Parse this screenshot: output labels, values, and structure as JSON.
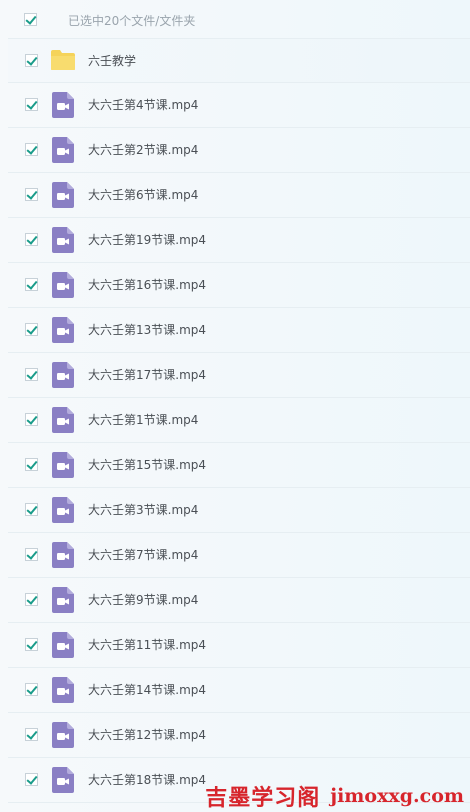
{
  "header": {
    "selection_text": "已选中20个文件/文件夹",
    "select_all_checked": true
  },
  "colors": {
    "checkmark": "#1a9c8a",
    "folder": "#f5d35a",
    "video_icon": "#8a7fc4",
    "watermark": "#d7252c"
  },
  "files": [
    {
      "name": "六壬教学",
      "type": "folder",
      "icon": "folder-icon",
      "checked": true
    },
    {
      "name": "大六壬第4节课.mp4",
      "type": "video",
      "icon": "video-file-icon",
      "checked": true
    },
    {
      "name": "大六壬第2节课.mp4",
      "type": "video",
      "icon": "video-file-icon",
      "checked": true
    },
    {
      "name": "大六壬第6节课.mp4",
      "type": "video",
      "icon": "video-file-icon",
      "checked": true
    },
    {
      "name": "大六壬第19节课.mp4",
      "type": "video",
      "icon": "video-file-icon",
      "checked": true
    },
    {
      "name": "大六壬第16节课.mp4",
      "type": "video",
      "icon": "video-file-icon",
      "checked": true
    },
    {
      "name": "大六壬第13节课.mp4",
      "type": "video",
      "icon": "video-file-icon",
      "checked": true
    },
    {
      "name": "大六壬第17节课.mp4",
      "type": "video",
      "icon": "video-file-icon",
      "checked": true
    },
    {
      "name": "大六壬第1节课.mp4",
      "type": "video",
      "icon": "video-file-icon",
      "checked": true
    },
    {
      "name": "大六壬第15节课.mp4",
      "type": "video",
      "icon": "video-file-icon",
      "checked": true
    },
    {
      "name": "大六壬第3节课.mp4",
      "type": "video",
      "icon": "video-file-icon",
      "checked": true
    },
    {
      "name": "大六壬第7节课.mp4",
      "type": "video",
      "icon": "video-file-icon",
      "checked": true
    },
    {
      "name": "大六壬第9节课.mp4",
      "type": "video",
      "icon": "video-file-icon",
      "checked": true
    },
    {
      "name": "大六壬第11节课.mp4",
      "type": "video",
      "icon": "video-file-icon",
      "checked": true
    },
    {
      "name": "大六壬第14节课.mp4",
      "type": "video",
      "icon": "video-file-icon",
      "checked": true
    },
    {
      "name": "大六壬第12节课.mp4",
      "type": "video",
      "icon": "video-file-icon",
      "checked": true
    },
    {
      "name": "大六壬第18节课.mp4",
      "type": "video",
      "icon": "video-file-icon",
      "checked": true
    }
  ],
  "watermark": {
    "cn": "吉墨学习阁",
    "en": "jimoxxg.com"
  }
}
